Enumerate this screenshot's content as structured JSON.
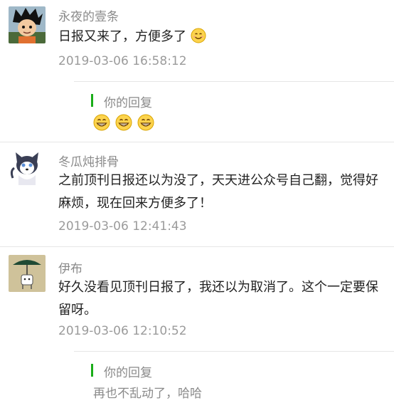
{
  "comments": [
    {
      "author": "永夜的壹条",
      "text": "日报又来了，方便多了",
      "text_emoji": "smiling-face-emoji",
      "time": "2019-03-06 16:58:12",
      "reply": {
        "label": "你的回复",
        "emojis": [
          "grinning-face-emoji",
          "grinning-face-emoji",
          "grinning-face-emoji"
        ]
      }
    },
    {
      "author": "冬瓜炖排骨",
      "text": "之前顶刊日报还以为没了，天天进公众号自己翻，觉得好麻烦，现在回来方便多了！",
      "time": "2019-03-06 12:41:43"
    },
    {
      "author": "伊布",
      "text": "好久没看见顶刊日报了，我还以为取消了。这个一定要保留呀。",
      "time": "2019-03-06 12:10:52",
      "reply": {
        "label": "你的回复",
        "text": "再也不乱动了，哈哈"
      }
    }
  ],
  "colors": {
    "reply_accent": "#1aad19",
    "emoji_yellow": "#fcd34d"
  }
}
